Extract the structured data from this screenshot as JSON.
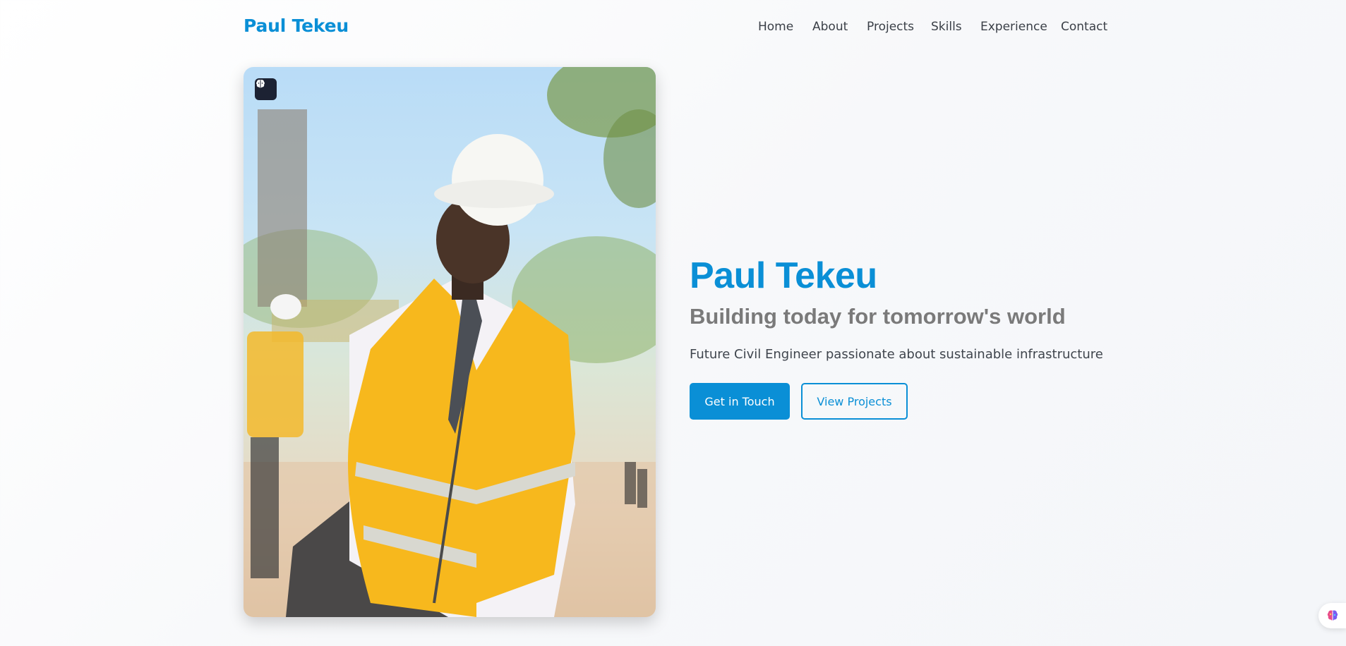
{
  "header": {
    "brand": "Paul Tekeu",
    "nav": [
      {
        "label": "Home"
      },
      {
        "label": "About"
      },
      {
        "label": "Projects"
      },
      {
        "label": "Skills"
      },
      {
        "label": "Experience"
      },
      {
        "label": "Contact"
      }
    ]
  },
  "hero": {
    "name": "Paul Tekeu",
    "tagline": "Building today for tomorrow's world",
    "description": "Future Civil Engineer passionate about sustainable infrastructure",
    "primary_button": "Get in Touch",
    "secondary_button": "View Projects",
    "photo_alt": "Engineer in hard hat and high-visibility safety vest",
    "badge_icon": "brain-icon"
  },
  "floating_widget": {
    "icon": "brain-colorful-icon"
  },
  "colors": {
    "accent": "#0a8fd6",
    "tagline": "#7a7a7a",
    "text": "#3f454d",
    "badge_bg": "#1c2233"
  }
}
